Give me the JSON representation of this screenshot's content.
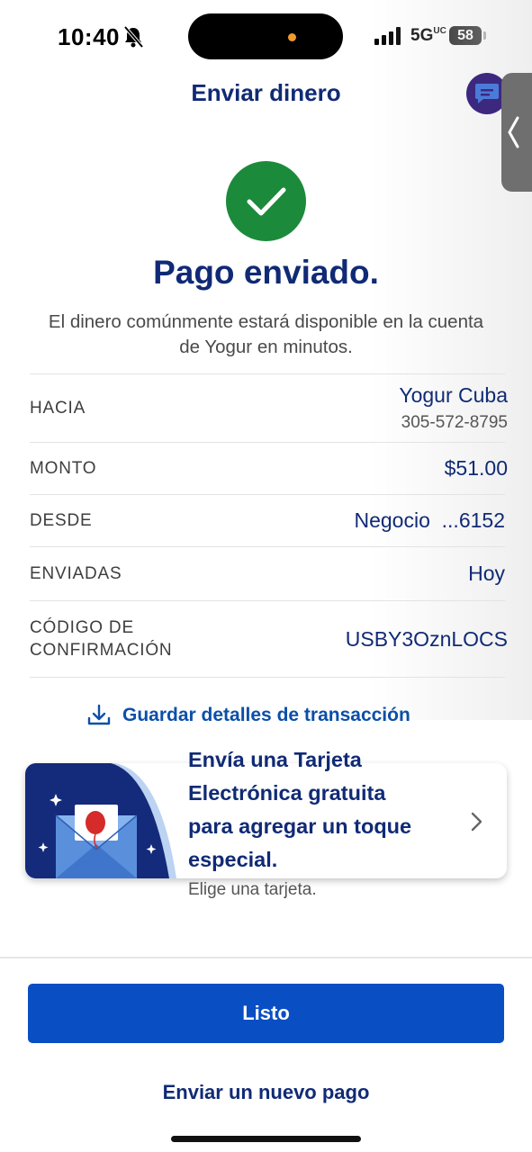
{
  "status_bar": {
    "time": "10:40",
    "network": "5G",
    "network_sub": "UC",
    "battery": "58"
  },
  "header": {
    "title": "Enviar dinero",
    "chat_icon": "chat-bubble-icon",
    "side_tab_icon": "chevron-left-icon"
  },
  "confirmation": {
    "icon": "check-icon",
    "title": "Pago enviado.",
    "message": "El dinero comúnmente estará disponible en la cuenta de Yogur en minutos."
  },
  "details": {
    "to": {
      "label": "HACIA",
      "name": "Yogur Cuba",
      "phone": "305-572-8795"
    },
    "amount": {
      "label": "MONTO",
      "value": "$51.00"
    },
    "from": {
      "label": "DESDE",
      "value": "Negocio  ...6152"
    },
    "sent": {
      "label": "ENVIADAS",
      "value": "Hoy"
    },
    "code": {
      "label_line1": "CÓDIGO DE",
      "label_line2": "CONFIRMACIÓN",
      "value": "USBY3OznLOCS"
    }
  },
  "save_link": {
    "label": "Guardar detalles de transacción",
    "icon": "download-icon"
  },
  "ecard": {
    "line1": "Envía una Tarjeta",
    "line2": "Electrónica gratuita",
    "line3": "para agregar un toque",
    "line4": "especial.",
    "subtitle": "Elige una tarjeta.",
    "icon": "envelope-balloon-icon"
  },
  "actions": {
    "done": "Listo",
    "new_payment": "Enviar un nuevo pago"
  },
  "colors": {
    "brand_navy": "#102a75",
    "primary_blue": "#0a4ec4",
    "success_green": "#1c8a3b",
    "link_blue": "#0b4fa8"
  }
}
